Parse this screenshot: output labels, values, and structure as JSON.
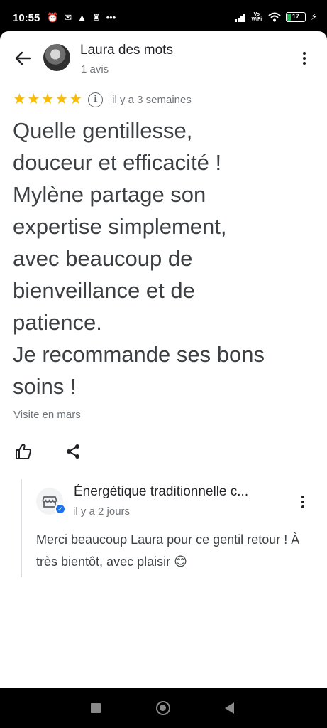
{
  "status_bar": {
    "time": "10:55",
    "battery": "17",
    "network": "Vo WiFi"
  },
  "header": {
    "author_name": "Laura des mots",
    "review_count": "1 avis",
    "icons": [
      "back-arrow-icon",
      "avatar",
      "more-vert-icon"
    ]
  },
  "review": {
    "rating": 5,
    "rating_max": 5,
    "stars": [
      "★",
      "★",
      "★",
      "★",
      "★"
    ],
    "info_symbol": "i",
    "date": "il y a 3 semaines",
    "text": "Quelle gentillesse,\ndouceur et efficacité !\nMylène partage son\nexpertise simplement,\navec beaucoup de\nbienveillance et de\npatience.\nJe recommande ses bons\nsoins !",
    "visit": "Visite en mars",
    "star_color": "#fbbc04"
  },
  "reply": {
    "owner_name": "Énergétique traditionnelle c...",
    "date": "il y a 2 jours",
    "text": "Merci beaucoup Laura pour ce gentil retour ! À très bientôt, avec plaisir 😊",
    "verified_mark": "✓",
    "verified_color": "#1a73e8"
  },
  "colors": {
    "text_primary": "#202124",
    "text_body": "#3c4043",
    "text_secondary": "#70757a",
    "icon": "#5f6368"
  }
}
